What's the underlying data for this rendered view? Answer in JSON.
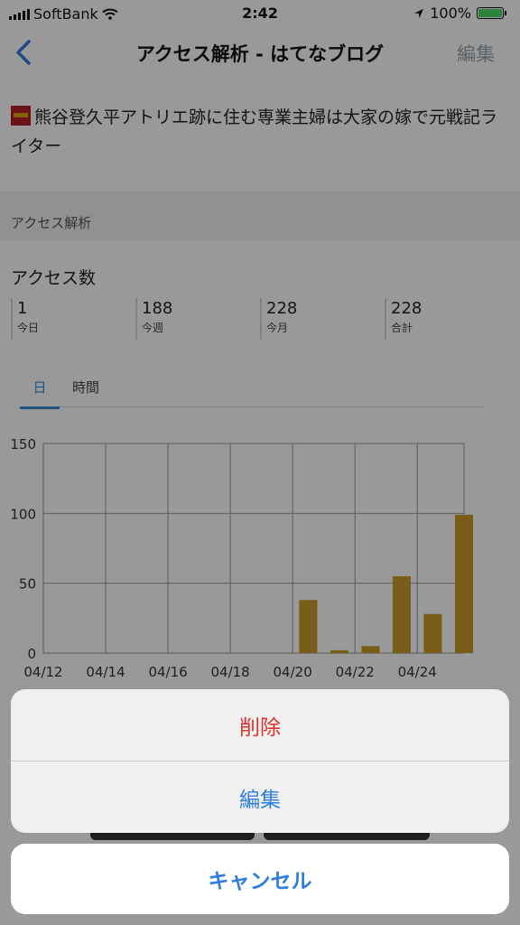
{
  "status_bar": {
    "carrier": "SoftBank",
    "time": "2:42",
    "battery": "100%"
  },
  "nav": {
    "title": "アクセス解析 - はてなブログ",
    "edit": "編集"
  },
  "blog": {
    "title": "熊谷登久平アトリエ跡に住む専業主婦は大家の嫁で元戦記ライター"
  },
  "section": {
    "label": "アクセス解析"
  },
  "access": {
    "heading": "アクセス数",
    "stats": [
      {
        "value": "1",
        "label": "今日"
      },
      {
        "value": "188",
        "label": "今週"
      },
      {
        "value": "228",
        "label": "今月"
      },
      {
        "value": "228",
        "label": "合計"
      }
    ]
  },
  "tabs": {
    "day": "日",
    "hour": "時間"
  },
  "chart_data": {
    "type": "bar",
    "categories": [
      "04/12",
      "04/13",
      "04/14",
      "04/15",
      "04/16",
      "04/17",
      "04/18",
      "04/19",
      "04/20",
      "04/21",
      "04/22",
      "04/23",
      "04/24",
      "04/25"
    ],
    "values": [
      0,
      0,
      0,
      0,
      0,
      0,
      0,
      0,
      38,
      2,
      5,
      55,
      28,
      99
    ],
    "x_tick_labels": [
      "04/12",
      "04/14",
      "04/16",
      "04/18",
      "04/20",
      "04/22",
      "04/24"
    ],
    "y_ticks": [
      "0",
      "50",
      "100",
      "150"
    ],
    "ylim": [
      0,
      150
    ],
    "bar_color": "#c89a28",
    "grid": true
  },
  "action_sheet": {
    "delete": "削除",
    "edit": "編集",
    "cancel": "キャンセル"
  },
  "colors": {
    "accent": "#2f7de1",
    "destructive": "#e0312c",
    "bar": "#c89a28"
  }
}
